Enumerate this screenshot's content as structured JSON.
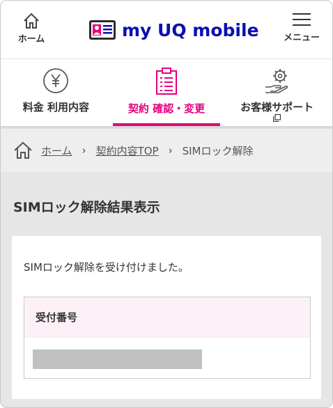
{
  "header": {
    "home_label": "ホーム",
    "logo_text": "my UQ mobile",
    "menu_label": "メニュー"
  },
  "tabs": [
    {
      "label": "料金 利用内容",
      "icon": "yen-icon",
      "active": false
    },
    {
      "label": "契約 確認・変更",
      "icon": "clipboard-icon",
      "active": true
    },
    {
      "label": "お客様サポート",
      "icon": "support-gear-icon",
      "active": false
    }
  ],
  "breadcrumb": {
    "items": [
      "ホーム",
      "契約内容TOP",
      "SIMロック解除"
    ]
  },
  "page": {
    "title": "SIMロック解除結果表示",
    "message": "SIMロック解除を受け付けました。",
    "receipt_header": "受付番号"
  },
  "colors": {
    "accent": "#e5007e",
    "brand": "#0b0fb0",
    "header_pink_bg": "#fdf1f7",
    "page_bg": "#e6e6e6"
  }
}
